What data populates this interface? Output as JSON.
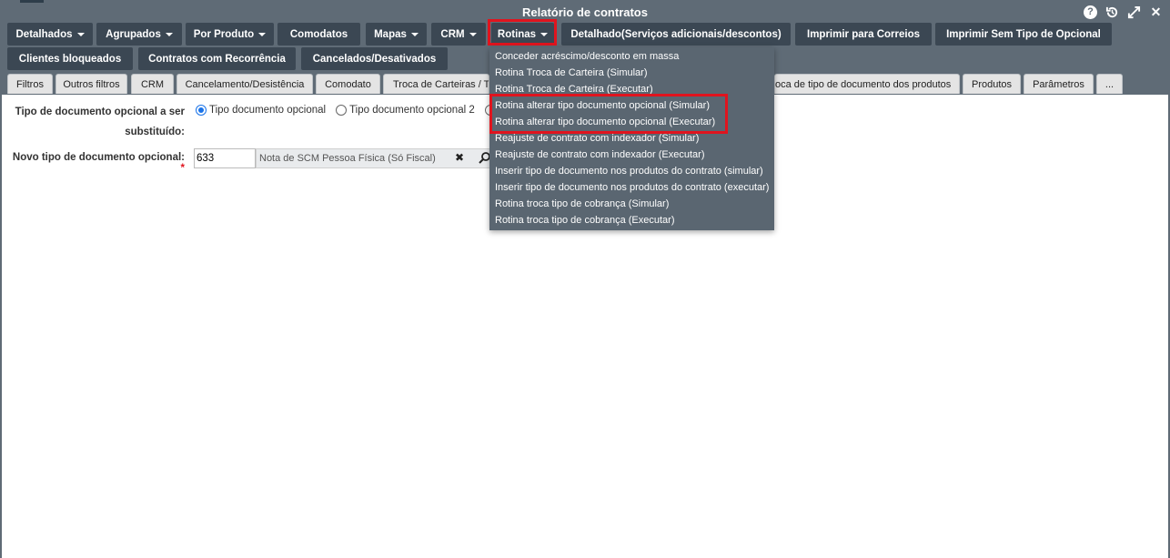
{
  "window": {
    "title": "Relatório de contratos"
  },
  "toolbar": {
    "row1": [
      {
        "label": "Detalhados",
        "caret": true
      },
      {
        "label": "Agrupados",
        "caret": true
      },
      {
        "label": "Por Produto",
        "caret": true
      },
      {
        "label": "Comodatos",
        "caret": false
      },
      {
        "label": "Mapas",
        "caret": true
      },
      {
        "label": "CRM",
        "caret": true
      },
      {
        "label": "Rotinas",
        "caret": true
      },
      {
        "label": "Detalhado(Serviços adicionais/descontos)",
        "caret": false
      },
      {
        "label": "Imprimir para Correios",
        "caret": false
      },
      {
        "label": "Imprimir Sem Tipo de Opcional",
        "caret": false
      }
    ],
    "row2": [
      {
        "label": "Clientes bloqueados"
      },
      {
        "label": "Contratos com Recorrência"
      },
      {
        "label": "Cancelados/Desativados"
      }
    ]
  },
  "tabs": [
    "Filtros",
    "Outros filtros",
    "CRM",
    "Cancelamento/Desistência",
    "Comodato",
    "Troca de Carteiras / T",
    "oca de tipo de documento dos produtos",
    "Produtos",
    "Parâmetros",
    "..."
  ],
  "form": {
    "replace_label_line1": "Tipo de documento opcional a ser",
    "replace_label_line2": "substituído:",
    "radio_options": [
      {
        "label": "Tipo documento opcional",
        "checked": true
      },
      {
        "label": "Tipo documento opcional 2",
        "checked": false
      },
      {
        "label": "T",
        "checked": false
      }
    ],
    "new_type_label": "Novo tipo de documento opcional:",
    "required_mark": "*",
    "code_value": "633",
    "description_value": "Nota de SCM Pessoa Física  (Só Fiscal)"
  },
  "dropdown": {
    "items": [
      "Conceder acréscimo/desconto em massa",
      "Rotina Troca de Carteira (Simular)",
      "Rotina Troca de Carteira (Executar)",
      "Rotina alterar tipo documento opcional (Simular)",
      "Rotina alterar tipo documento opcional (Executar)",
      "Reajuste de contrato com indexador (Simular)",
      "Reajuste de contrato com indexador (Executar)",
      "Inserir tipo de documento nos produtos do contrato (simular)",
      "Inserir tipo de documento nos produtos do contrato (executar)",
      "Rotina troca tipo de cobrança (Simular)",
      "Rotina troca tipo de cobrança (Executar)"
    ]
  },
  "icons": {
    "title_bar": [
      "help-icon",
      "history-icon",
      "expand-icon",
      "close-icon"
    ],
    "field": [
      "clear-icon",
      "search-icon"
    ]
  },
  "colors": {
    "header_bg": "#5f6b76",
    "button_bg": "#3b4753",
    "highlight": "#e0141e",
    "dropdown_bg": "#5a6671"
  }
}
